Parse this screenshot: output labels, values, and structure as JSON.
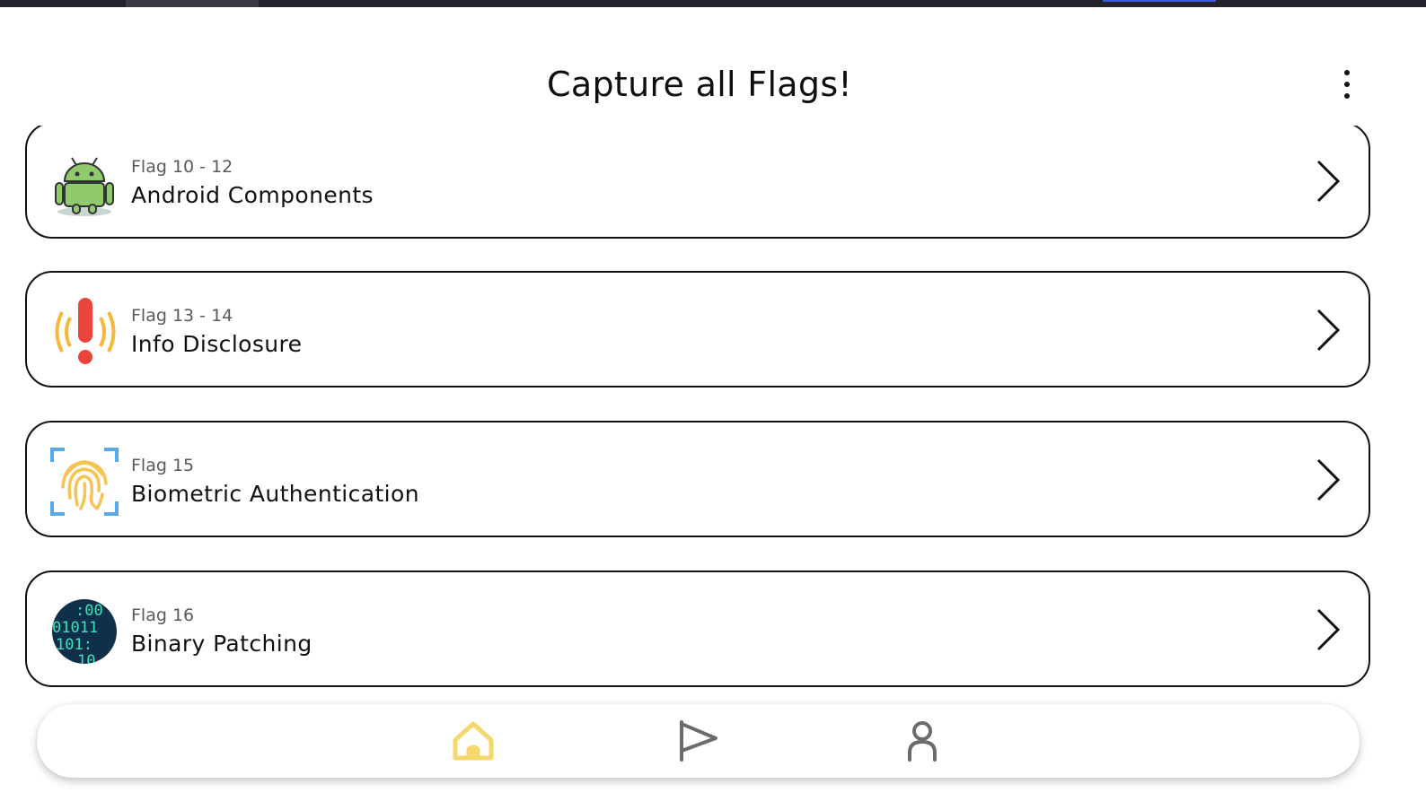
{
  "header": {
    "title": "Capture all Flags!"
  },
  "cards": [
    {
      "subtitle": "Flag 10 - 12",
      "title": "Android Components",
      "icon": "android-robot-icon"
    },
    {
      "subtitle": "Flag 13 - 14",
      "title": "Info Disclosure",
      "icon": "exclamation-broadcast-icon"
    },
    {
      "subtitle": "Flag 15",
      "title": "Biometric Authentication",
      "icon": "fingerprint-icon"
    },
    {
      "subtitle": "Flag 16",
      "title": "Binary Patching",
      "icon": "binary-code-icon"
    }
  ],
  "nav": {
    "items": [
      {
        "icon": "home-icon",
        "active": true
      },
      {
        "icon": "flag-icon",
        "active": false
      },
      {
        "icon": "user-icon",
        "active": false
      }
    ],
    "active_color": "#f5d76e",
    "inactive_color": "#6b6b6b"
  },
  "colors": {
    "status_bar": "#24232b",
    "card_border": "#111111"
  }
}
